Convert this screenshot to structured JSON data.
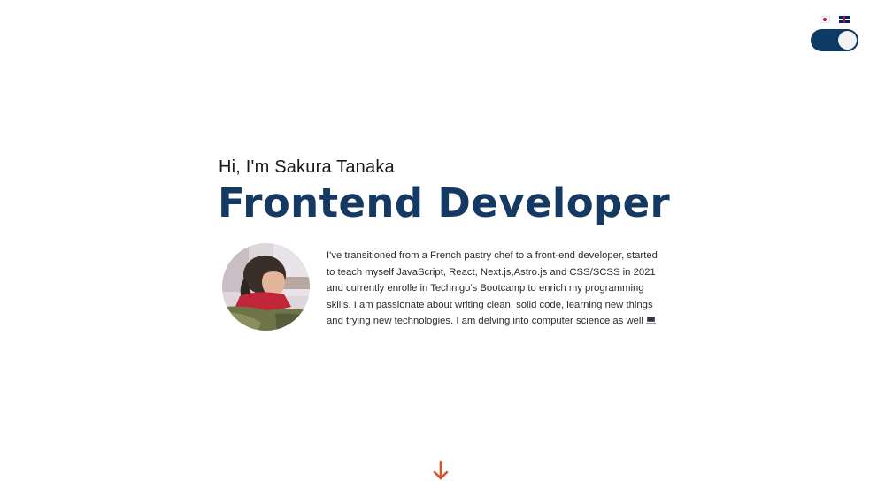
{
  "header": {
    "languages": [
      {
        "code": "ja",
        "icon": "japan-flag-icon"
      },
      {
        "code": "en",
        "icon": "uk-flag-icon"
      }
    ],
    "theme_toggle": {
      "state": "on",
      "track_color": "#0d3b66",
      "knob_color": "#f2f2f2"
    }
  },
  "hero": {
    "greeting": "Hi, I'm Sakura Tanaka",
    "title": "Frontend Developer",
    "title_color": "#143a63",
    "bio": "I've transitioned from a French pastry chef to a front-end developer, started to teach myself JavaScript, React, Next.js,Astro.js and CSS/SCSS in 2021 and currently enrolle in Technigo's Bootcamp to enrich my programming skills. I am passionate about writing clean, solid code, learning new things and trying new technologies. I am delving into computer science as well",
    "bio_icon": "laptop-icon"
  },
  "scroll_indicator": {
    "icon": "arrow-down-icon",
    "color": "#d9532c"
  }
}
